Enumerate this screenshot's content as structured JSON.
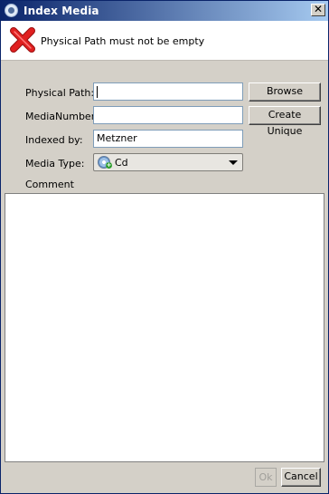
{
  "window": {
    "title": "Index Media"
  },
  "error": {
    "message": "Physical Path must not be empty"
  },
  "form": {
    "physical_path": {
      "label": "Physical Path:",
      "value": "",
      "button": "Browse"
    },
    "media_number": {
      "label": "MediaNumber:",
      "value": "",
      "button": "Create Unique"
    },
    "indexed_by": {
      "label": "Indexed by:",
      "value": "Metzner"
    },
    "media_type": {
      "label": "Media Type:",
      "selected": "Cd",
      "icon": "cd-icon"
    },
    "comment": {
      "label": "Comment",
      "value": ""
    }
  },
  "footer": {
    "ok_label": "Ok",
    "cancel_label": "Cancel"
  },
  "colors": {
    "titlebar_start": "#0a246a",
    "titlebar_end": "#a6caf0",
    "dialog_bg": "#d4d0c8",
    "error_red": "#e02020"
  }
}
